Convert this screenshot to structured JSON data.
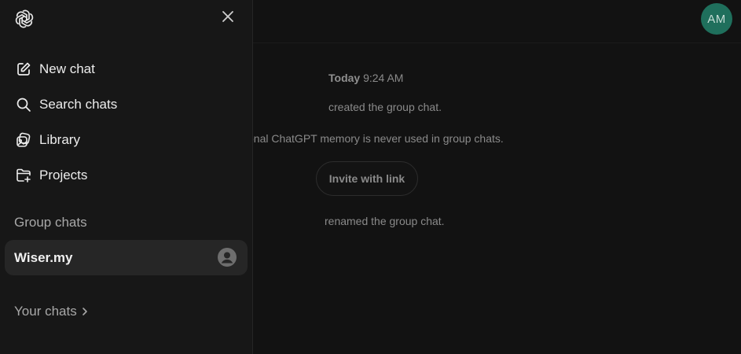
{
  "sidebar": {
    "nav": [
      {
        "label": "New chat",
        "icon": "edit-icon"
      },
      {
        "label": "Search chats",
        "icon": "search-icon"
      },
      {
        "label": "Library",
        "icon": "library-icon"
      },
      {
        "label": "Projects",
        "icon": "folder-plus-icon"
      }
    ],
    "group_chats_title": "Group chats",
    "group_chats": [
      {
        "label": "Wiser.my",
        "icon": "person-icon"
      }
    ],
    "your_chats_label": "Your chats"
  },
  "header": {
    "avatar_initials": "AM"
  },
  "timeline": {
    "today_label": "Today",
    "time": "9:24 AM",
    "created_text": "created the group chat.",
    "memory_text": "sonal ChatGPT memory is never used in group chats.",
    "invite_button_label": "Invite with link",
    "renamed_text": "renamed the group chat."
  },
  "colors": {
    "background": "#121212",
    "sidebar_bg": "#171717",
    "selected_item_bg": "#262626",
    "avatar_bg": "#1f6f5c"
  }
}
